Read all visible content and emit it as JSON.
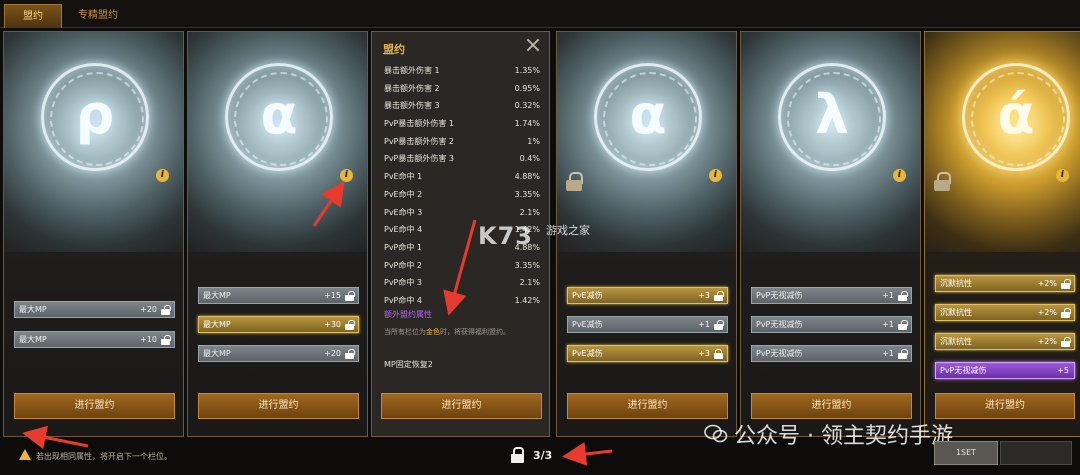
{
  "tabs": [
    {
      "label": "盟约",
      "active": true
    },
    {
      "label": "专精盟约",
      "active": false
    }
  ],
  "cards": [
    {
      "glyph": "ρ",
      "locked": false,
      "gold": false,
      "slots": [
        {
          "label": "最大MP",
          "value": "+20",
          "style": "grey",
          "lock": "open"
        },
        {
          "label": "最大MP",
          "value": "+10",
          "style": "grey",
          "lock": "open"
        }
      ],
      "button": "进行盟约"
    },
    {
      "glyph": "α",
      "locked": false,
      "gold": false,
      "slots": [
        {
          "label": "最大MP",
          "value": "+15",
          "style": "grey",
          "lock": "open"
        },
        {
          "label": "最大MP",
          "value": "+30",
          "style": "gold",
          "lock": "open"
        },
        {
          "label": "最大MP",
          "value": "+20",
          "style": "grey",
          "lock": "open"
        }
      ],
      "button": "进行盟约"
    },
    {
      "glyph": "α",
      "locked": true,
      "gold": false,
      "slots": [
        {
          "label": "PvE减伤",
          "value": "+3",
          "style": "gold",
          "lock": "open"
        },
        {
          "label": "PvE减伤",
          "value": "+1",
          "style": "grey",
          "lock": "open"
        },
        {
          "label": "PvE减伤",
          "value": "+3",
          "style": "gold",
          "lock": "closed"
        }
      ],
      "button": "进行盟约"
    },
    {
      "glyph": "λ",
      "locked": false,
      "gold": false,
      "slots": [
        {
          "label": "PvP无视减伤",
          "value": "+1",
          "style": "grey",
          "lock": "open"
        },
        {
          "label": "PvP无视减伤",
          "value": "+1",
          "style": "grey",
          "lock": "open"
        },
        {
          "label": "PvP无视减伤",
          "value": "+1",
          "style": "grey",
          "lock": "open"
        }
      ],
      "button": "进行盟约"
    },
    {
      "glyph": "ά",
      "locked": true,
      "gold": true,
      "slots": [
        {
          "label": "沉默抗性",
          "value": "+2%",
          "style": "gold",
          "lock": "open"
        },
        {
          "label": "沉默抗性",
          "value": "+2%",
          "style": "gold",
          "lock": "open"
        },
        {
          "label": "沉默抗性",
          "value": "+2%",
          "style": "gold",
          "lock": "open"
        },
        {
          "label": "PvP无视减伤",
          "value": "+5",
          "style": "purple",
          "lock": "none"
        }
      ],
      "button": "进行盟约"
    }
  ],
  "popup": {
    "title": "盟约",
    "stats": [
      {
        "label": "暴击额外伤害 1",
        "value": "1.35%"
      },
      {
        "label": "暴击额外伤害 2",
        "value": "0.95%"
      },
      {
        "label": "暴击额外伤害 3",
        "value": "0.32%"
      },
      {
        "label": "PvP暴击额外伤害 1",
        "value": "1.74%"
      },
      {
        "label": "PvP暴击额外伤害 2",
        "value": "1%"
      },
      {
        "label": "PvP暴击额外伤害 3",
        "value": "0.4%"
      },
      {
        "label": "PvE命中 1",
        "value": "4.88%"
      },
      {
        "label": "PvE命中 2",
        "value": "3.35%"
      },
      {
        "label": "PvE命中 3",
        "value": "2.1%"
      },
      {
        "label": "PvE命中 4",
        "value": "1.42%"
      },
      {
        "label": "PvP命中 1",
        "value": "4.88%"
      },
      {
        "label": "PvP命中 2",
        "value": "3.35%"
      },
      {
        "label": "PvP命中 3",
        "value": "2.1%"
      },
      {
        "label": "PvP命中 4",
        "value": "1.42%"
      }
    ],
    "extra_title": "额外盟约属性",
    "extra_desc_pre": "当所有栏位为",
    "extra_desc_gold": "金色",
    "extra_desc_post": "时，将获得福利盟约。",
    "mp_recover": "MP固定恢复2",
    "button": "进行盟约"
  },
  "footer": {
    "warning": "若出现相同属性，将开启下一个栏位。",
    "page": "3/3",
    "set1": "1SET",
    "set2": ""
  },
  "watermarks": {
    "k73": "K73",
    "k73_sub": "游戏之家",
    "wechat": "公众号 · 领主契约手游"
  },
  "colors": {
    "accent_gold": "#e4b354",
    "purple": "#b068f0",
    "arrow_red": "#e63b2e"
  }
}
